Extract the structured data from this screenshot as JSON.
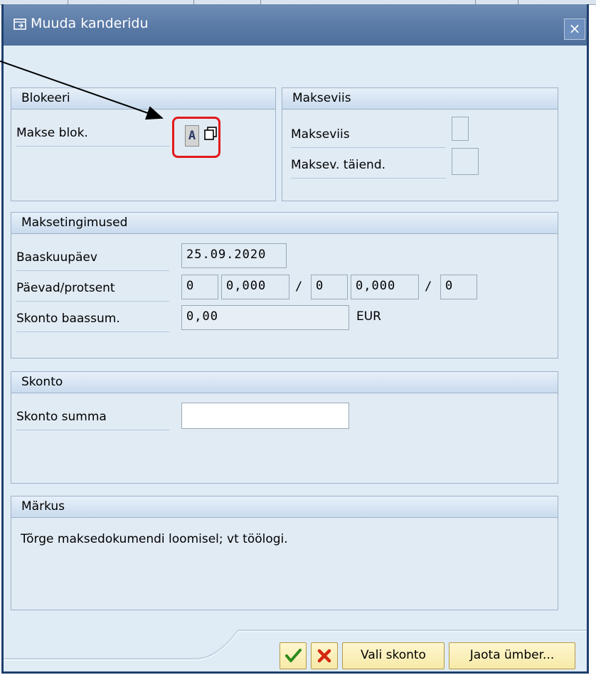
{
  "dialog": {
    "title": "Muuda kanderidu",
    "close_symbol": "×"
  },
  "blokeeri": {
    "title": "Blokeeri",
    "makse_blok_label": "Makse blok.",
    "makse_blok_value": "A"
  },
  "makseviis": {
    "title": "Makseviis",
    "makseviis_label": "Makseviis",
    "makseviis_value": "",
    "taiend_label": "Maksev. täiend.",
    "taiend_value": ""
  },
  "maksetingimused": {
    "title": "Maksetingimused",
    "baaskuupaev_label": "Baaskuupäev",
    "baaskuupaev_value": "25.09.2020",
    "paevad_label": "Päevad/protsent",
    "days1": "0",
    "pct1": "0,000",
    "days2": "0",
    "pct2": "0,000",
    "days3": "0",
    "slash": "/",
    "skonto_baas_label": "Skonto baassum.",
    "skonto_baas_value": "0,00",
    "currency": "EUR"
  },
  "skonto": {
    "title": "Skonto",
    "summa_label": "Skonto summa",
    "summa_value": ""
  },
  "markus": {
    "title": "Märkus",
    "text": "Tõrge maksedokumendi loomisel; vt töölogi."
  },
  "buttons": {
    "confirm_icon": "check-icon",
    "cancel_icon": "cancel-icon",
    "vali_skonto": "Vali skonto",
    "jaota_umber": "Jaota ümber..."
  },
  "colors": {
    "title_bar": "#5a7aa6",
    "dialog_bg": "#dfebf5",
    "highlight_box": "#e21a1a",
    "button_bg": "#f6e9a7"
  }
}
